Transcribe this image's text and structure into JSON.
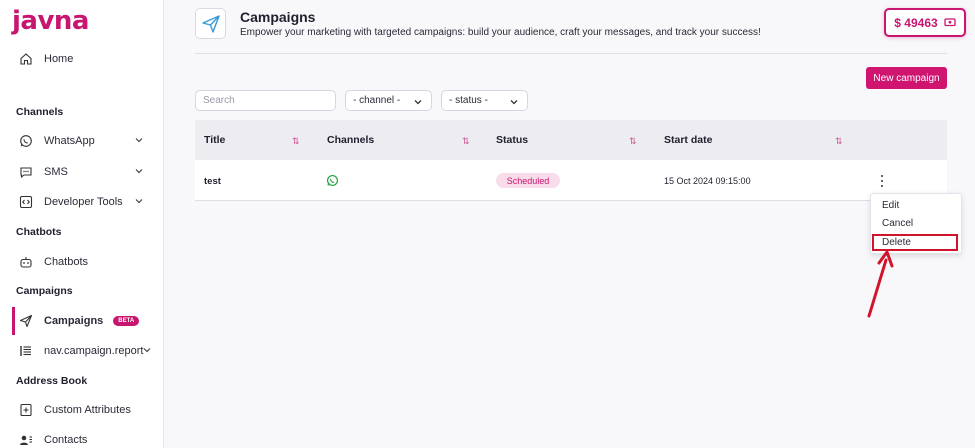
{
  "brand": {
    "logo_text": "javna",
    "color": "#c8156f"
  },
  "sidebar": {
    "home": "Home",
    "sections": {
      "channels": "Channels",
      "chatbots": "Chatbots",
      "campaigns": "Campaigns",
      "address_book": "Address Book"
    },
    "items": {
      "whatsapp": "WhatsApp",
      "sms": "SMS",
      "developer_tools": "Developer Tools",
      "chatbots": "Chatbots",
      "campaigns": "Campaigns",
      "campaigns_badge": "BETA",
      "campaign_report": "nav.campaign.report",
      "custom_attributes": "Custom Attributes",
      "contacts": "Contacts"
    }
  },
  "header": {
    "title": "Campaigns",
    "subtitle": "Empower your marketing with targeted campaigns: build your audience, craft your messages, and track your success!",
    "balance": "$ 49463"
  },
  "toolbar": {
    "new_campaign": "New campaign",
    "search_placeholder": "Search",
    "channel_select": "- channel -",
    "status_select": "- status -"
  },
  "table": {
    "columns": [
      "Title",
      "Channels",
      "Status",
      "Start date"
    ],
    "rows": [
      {
        "title": "test",
        "channel_icon": "whatsapp-icon",
        "status": "Scheduled",
        "start_date": "15 Oct 2024 09:15:00"
      }
    ]
  },
  "row_menu": {
    "items": [
      "Edit",
      "Cancel",
      "Delete"
    ],
    "highlighted": "Delete"
  },
  "colors": {
    "accent": "#c8156f",
    "annotation": "#d0142c",
    "whatsapp": "#25a244"
  }
}
